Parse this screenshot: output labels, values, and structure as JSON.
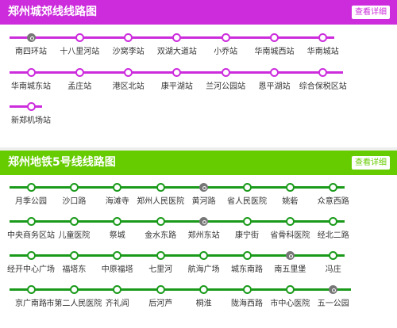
{
  "colors": {
    "page_bg": "#eeeeee",
    "chengjiao": "#cc2cdc",
    "line5_header": "#66cc00",
    "line5": "#1a9a1a",
    "transfer": "#777777",
    "station_text": "#333333"
  },
  "panels": [
    {
      "id": "chengjiao",
      "title": "郑州城郊线线路图",
      "detail_label": "查看详细",
      "rows": [
        {
          "stations": [
            {
              "name": "南四环站",
              "transfer": true
            },
            {
              "name": "十八里河站",
              "transfer": false
            },
            {
              "name": "沙窝李站",
              "transfer": false
            },
            {
              "name": "双湖大道站",
              "transfer": false
            },
            {
              "name": "小乔站",
              "transfer": false
            },
            {
              "name": "华南城西站",
              "transfer": false
            },
            {
              "name": "华南城站",
              "transfer": false
            }
          ]
        },
        {
          "stations": [
            {
              "name": "华南城东站",
              "transfer": false
            },
            {
              "name": "孟庄站",
              "transfer": false
            },
            {
              "name": "港区北站",
              "transfer": false
            },
            {
              "name": "康平湖站",
              "transfer": false
            },
            {
              "name": "兰河公园站",
              "transfer": false
            },
            {
              "name": "恩平湖站",
              "transfer": false
            },
            {
              "name": "综合保税区站",
              "transfer": false
            }
          ]
        },
        {
          "stations": [
            {
              "name": "新郑机场站",
              "transfer": false
            }
          ]
        }
      ]
    },
    {
      "id": "line5",
      "title": "郑州地铁5号线线路图",
      "detail_label": "查看详细",
      "rows": [
        {
          "stations": [
            {
              "name": "月季公园",
              "transfer": false
            },
            {
              "name": "沙口路",
              "transfer": false
            },
            {
              "name": "海滩寺",
              "transfer": false
            },
            {
              "name": "郑州人民医院",
              "transfer": false
            },
            {
              "name": "黄河路",
              "transfer": true
            },
            {
              "name": "省人民医院",
              "transfer": false
            },
            {
              "name": "姚砦",
              "transfer": false
            },
            {
              "name": "众意西路",
              "transfer": false
            }
          ]
        },
        {
          "stations": [
            {
              "name": "中央商务区站",
              "transfer": false
            },
            {
              "name": "儿童医院",
              "transfer": false
            },
            {
              "name": "祭城",
              "transfer": false
            },
            {
              "name": "金水东路",
              "transfer": false
            },
            {
              "name": "郑州东站",
              "transfer": true
            },
            {
              "name": "康宁街",
              "transfer": false
            },
            {
              "name": "省骨科医院",
              "transfer": false
            },
            {
              "name": "经北二路",
              "transfer": false
            }
          ]
        },
        {
          "stations": [
            {
              "name": "经开中心广场",
              "transfer": false
            },
            {
              "name": "福塔东",
              "transfer": false
            },
            {
              "name": "中原福塔",
              "transfer": false
            },
            {
              "name": "七里河",
              "transfer": false
            },
            {
              "name": "航海广场",
              "transfer": false
            },
            {
              "name": "城东南路",
              "transfer": false
            },
            {
              "name": "南五里堡",
              "transfer": true
            },
            {
              "name": "冯庄",
              "transfer": false
            }
          ]
        },
        {
          "stations": [
            {
              "name": "京广南路",
              "transfer": false
            },
            {
              "name": "市第二人民医院",
              "transfer": false
            },
            {
              "name": "齐礼阎",
              "transfer": false
            },
            {
              "name": "后河芦",
              "transfer": false
            },
            {
              "name": "桐淮",
              "transfer": false
            },
            {
              "name": "陇海西路",
              "transfer": false
            },
            {
              "name": "市中心医院",
              "transfer": false
            },
            {
              "name": "五一公园",
              "transfer": true
            }
          ]
        }
      ]
    }
  ]
}
